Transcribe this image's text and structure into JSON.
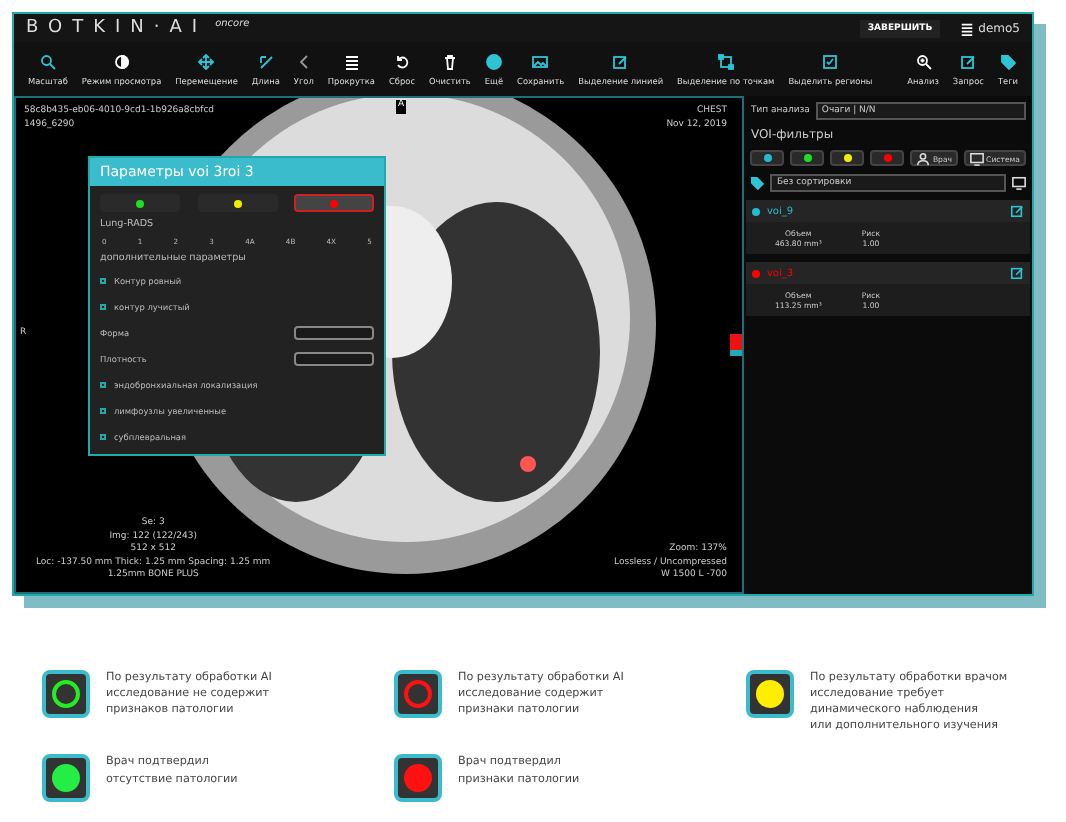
{
  "header": {
    "logo": "BOTKIN·AI",
    "logo_suffix": "oncore",
    "finish_button": "ЗАВЕРШИТЬ",
    "user": "demo5"
  },
  "toolbar": [
    {
      "label": "Масштаб",
      "kind": "search"
    },
    {
      "label": "Режим просмотра",
      "kind": "contrast"
    },
    {
      "label": "Перемещение",
      "kind": "move"
    },
    {
      "label": "Длина",
      "kind": "ruler"
    },
    {
      "label": "Угол",
      "kind": "angle"
    },
    {
      "label": "Прокрутка",
      "kind": "list"
    },
    {
      "label": "Сброс",
      "kind": "undo"
    },
    {
      "label": "Очистить",
      "kind": "trash"
    },
    {
      "label": "Ещё",
      "kind": "more"
    },
    {
      "label": "Сохранить",
      "kind": "image"
    },
    {
      "label": "Выделение линией",
      "kind": "edit"
    },
    {
      "label": "Выделение по точкам",
      "kind": "points"
    },
    {
      "label": "Выделить регионы",
      "kind": "check"
    }
  ],
  "toolbar_right": [
    {
      "label": "Анализ",
      "kind": "zoom"
    },
    {
      "label": "Запрос",
      "kind": "note"
    },
    {
      "label": "Теги",
      "kind": "tag"
    }
  ],
  "viewer": {
    "study_id": "58c8b435-eb06-4010-9cd1-1b926a8cbfcd",
    "study_sub": "1496_6290",
    "orientation_top": "A",
    "orientation_left": "R",
    "body_part": "CHEST",
    "date": "Nov 12, 2019",
    "info_left": [
      "Se: 3",
      "Img: 122 (122/243)",
      "512 x 512",
      "Loc: -137.50 mm Thick: 1.25 mm Spacing: 1.25 mm",
      "1.25mm BONE PLUS"
    ],
    "info_right": [
      "Zoom: 137%",
      "Lossless / Uncompressed",
      "W 1500 L -700"
    ]
  },
  "panel": {
    "title": "Параметры voi 3roi 3",
    "status_options": [
      {
        "color": "#22dd22",
        "selected": false
      },
      {
        "color": "#eeee00",
        "selected": false
      },
      {
        "color": "#ff0000",
        "selected": true
      }
    ],
    "rads_label": "Lung-RADS",
    "rads_values": [
      "0",
      "1",
      "2",
      "3",
      "4A",
      "4B",
      "4X",
      "5"
    ],
    "extra_title": "дополнительные параметры",
    "params": [
      {
        "kind": "checkbox",
        "label": "Контур ровный",
        "checked": false
      },
      {
        "kind": "checkbox",
        "label": "контур лучистый",
        "checked": false
      },
      {
        "kind": "select",
        "label": "Форма"
      },
      {
        "kind": "select",
        "label": "Плотность"
      },
      {
        "kind": "checkbox",
        "label": "эндобронхиальная локализация",
        "checked": false
      },
      {
        "kind": "checkbox",
        "label": "лимфоузлы увеличенные",
        "checked": false
      },
      {
        "kind": "checkbox",
        "label": "субплевральная",
        "checked": false
      }
    ]
  },
  "analysis": {
    "type_label": "Тип анализа",
    "type_value": "Очаги | N/N",
    "filters_title": "VOI-фильтры",
    "color_filters": [
      {
        "color": "#22bbcc"
      },
      {
        "color": "#22dd22"
      },
      {
        "color": "#eeee00"
      },
      {
        "color": "#ff0000"
      }
    ],
    "source_filters": [
      {
        "label": "Врач",
        "kind": "person"
      },
      {
        "label": "Система",
        "kind": "screen"
      }
    ],
    "sort_value": "Без сортировки",
    "vois": [
      {
        "name": "voi_9",
        "color": "#22bbcc",
        "volume_label": "Объем",
        "volume": "463.80 mm³",
        "risk_label": "Риск",
        "risk": "1.00"
      },
      {
        "name": "voi_3",
        "color": "#ff0000",
        "volume_label": "Объем",
        "volume": "113.25 mm³",
        "risk_label": "Риск",
        "risk": "1.00"
      }
    ]
  },
  "legend": [
    {
      "kind": "ring",
      "color": "#22ee22",
      "lines": [
        "По результату обработки AI",
        "исследование не содержит",
        "признаков патологии"
      ]
    },
    {
      "kind": "ring",
      "color": "#ff1111",
      "lines": [
        "По результату обработки AI",
        "исследование содержит",
        "признаки патологии"
      ]
    },
    {
      "kind": "fill",
      "color": "#ffee00",
      "lines": [
        "По результату обработки врачом",
        "исследование требует",
        "динамического наблюдения",
        "или дополнительного изучения"
      ]
    },
    {
      "kind": "fill",
      "color": "#22ee44",
      "lines": [
        "Врач подтвердил",
        "отсутствие патологии"
      ]
    },
    {
      "kind": "fill",
      "color": "#ff1111",
      "lines": [
        "Врач подтвердил",
        "признаки патологии"
      ]
    }
  ]
}
